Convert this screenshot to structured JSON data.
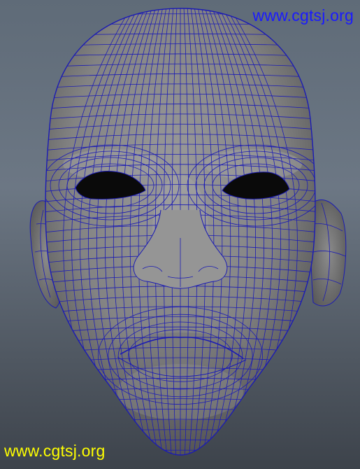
{
  "watermark": {
    "top_text": "www.cgtsj.org",
    "bottom_text": "www.cgtsj.org",
    "top_color": "#1a1aff",
    "bottom_color": "#ffff00"
  },
  "viewport": {
    "background_top": "#5f6b78",
    "background_bottom": "#3d434b",
    "mesh_color": "#1b1bb4",
    "surface_color": "#8a8a8a"
  }
}
